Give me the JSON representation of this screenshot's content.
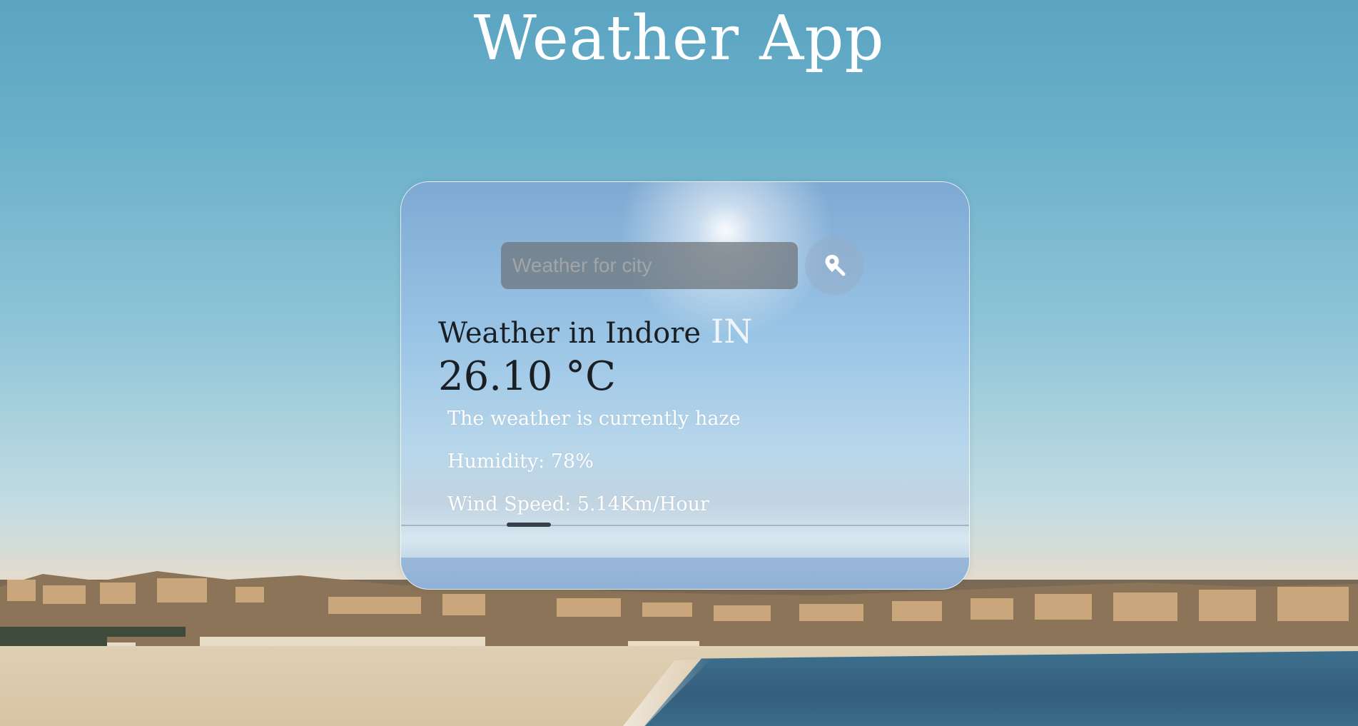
{
  "app": {
    "title": "Weather App"
  },
  "search": {
    "placeholder": "Weather for city",
    "value": "",
    "button_icon": "map-pin-search-icon"
  },
  "weather": {
    "city_line": "Weather in Indore",
    "country_code": "IN",
    "temperature": "26.10 °C",
    "description": "The weather is currently haze",
    "humidity": "Humidity: 78%",
    "wind": "Wind Speed: 5.14Km/Hour"
  },
  "colors": {
    "title_text": "#ffffff",
    "primary_text": "#1a1f24",
    "secondary_text": "#ffffff",
    "input_bg": "#6e7378"
  }
}
